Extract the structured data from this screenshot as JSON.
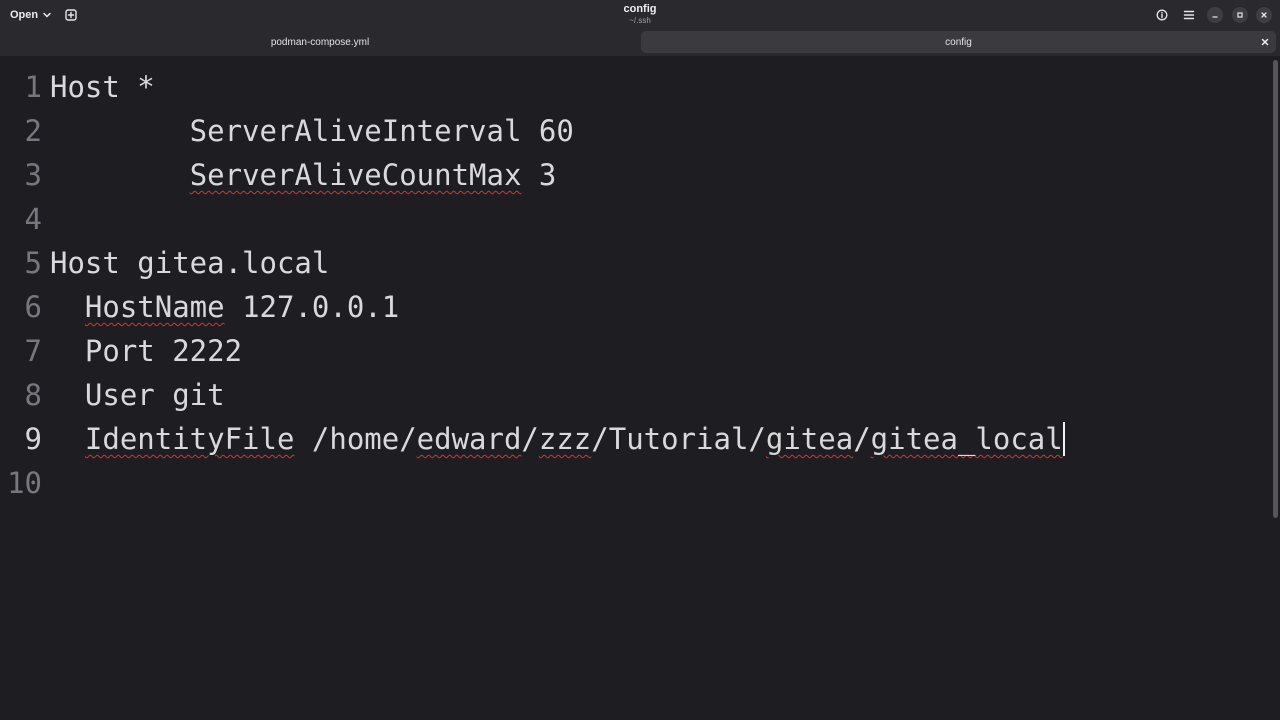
{
  "header": {
    "open_label": "Open",
    "title": "config",
    "subtitle": "~/.ssh"
  },
  "tabs": [
    {
      "label": "podman-compose.yml",
      "active": false
    },
    {
      "label": "config",
      "active": true
    }
  ],
  "icons": {
    "open_dropdown": "chevron-down-icon",
    "new_tab": "new-tab-icon",
    "document_properties": "info-icon",
    "main_menu": "hamburger-menu-icon",
    "minimize": "minimize-icon",
    "maximize": "maximize-icon",
    "close": "close-icon",
    "tab_close": "close-icon"
  },
  "colors": {
    "background": "#1e1e22",
    "headerbar": "#2a2a2e",
    "active_tab": "#3a3a3f",
    "spellcheck": "#d0363a"
  },
  "editor": {
    "current_line": 9,
    "lines": [
      {
        "num": "1",
        "segments": [
          {
            "text": "Host *",
            "spell": false
          }
        ]
      },
      {
        "num": "2",
        "segments": [
          {
            "text": "        ServerAliveInterval 60",
            "spell": false
          }
        ]
      },
      {
        "num": "3",
        "segments": [
          {
            "text": "        ",
            "spell": false
          },
          {
            "text": "ServerAliveCountMax",
            "spell": true
          },
          {
            "text": " 3",
            "spell": false
          }
        ]
      },
      {
        "num": "4",
        "segments": [
          {
            "text": "",
            "spell": false
          }
        ]
      },
      {
        "num": "5",
        "segments": [
          {
            "text": "Host gitea.local",
            "spell": false
          }
        ]
      },
      {
        "num": "6",
        "segments": [
          {
            "text": "  ",
            "spell": false
          },
          {
            "text": "HostName",
            "spell": true
          },
          {
            "text": " 127.0.0.1",
            "spell": false
          }
        ]
      },
      {
        "num": "7",
        "segments": [
          {
            "text": "  Port 2222",
            "spell": false
          }
        ]
      },
      {
        "num": "8",
        "segments": [
          {
            "text": "  User git",
            "spell": false
          }
        ]
      },
      {
        "num": "9",
        "segments": [
          {
            "text": "  ",
            "spell": false
          },
          {
            "text": "IdentityFile",
            "spell": true
          },
          {
            "text": " /home/",
            "spell": false
          },
          {
            "text": "edward",
            "spell": true
          },
          {
            "text": "/",
            "spell": false
          },
          {
            "text": "zzz",
            "spell": true
          },
          {
            "text": "/Tutorial/",
            "spell": false
          },
          {
            "text": "gitea",
            "spell": true
          },
          {
            "text": "/",
            "spell": false
          },
          {
            "text": "gitea_local",
            "spell": true
          }
        ]
      },
      {
        "num": "10",
        "segments": [
          {
            "text": "",
            "spell": false
          }
        ]
      }
    ]
  }
}
